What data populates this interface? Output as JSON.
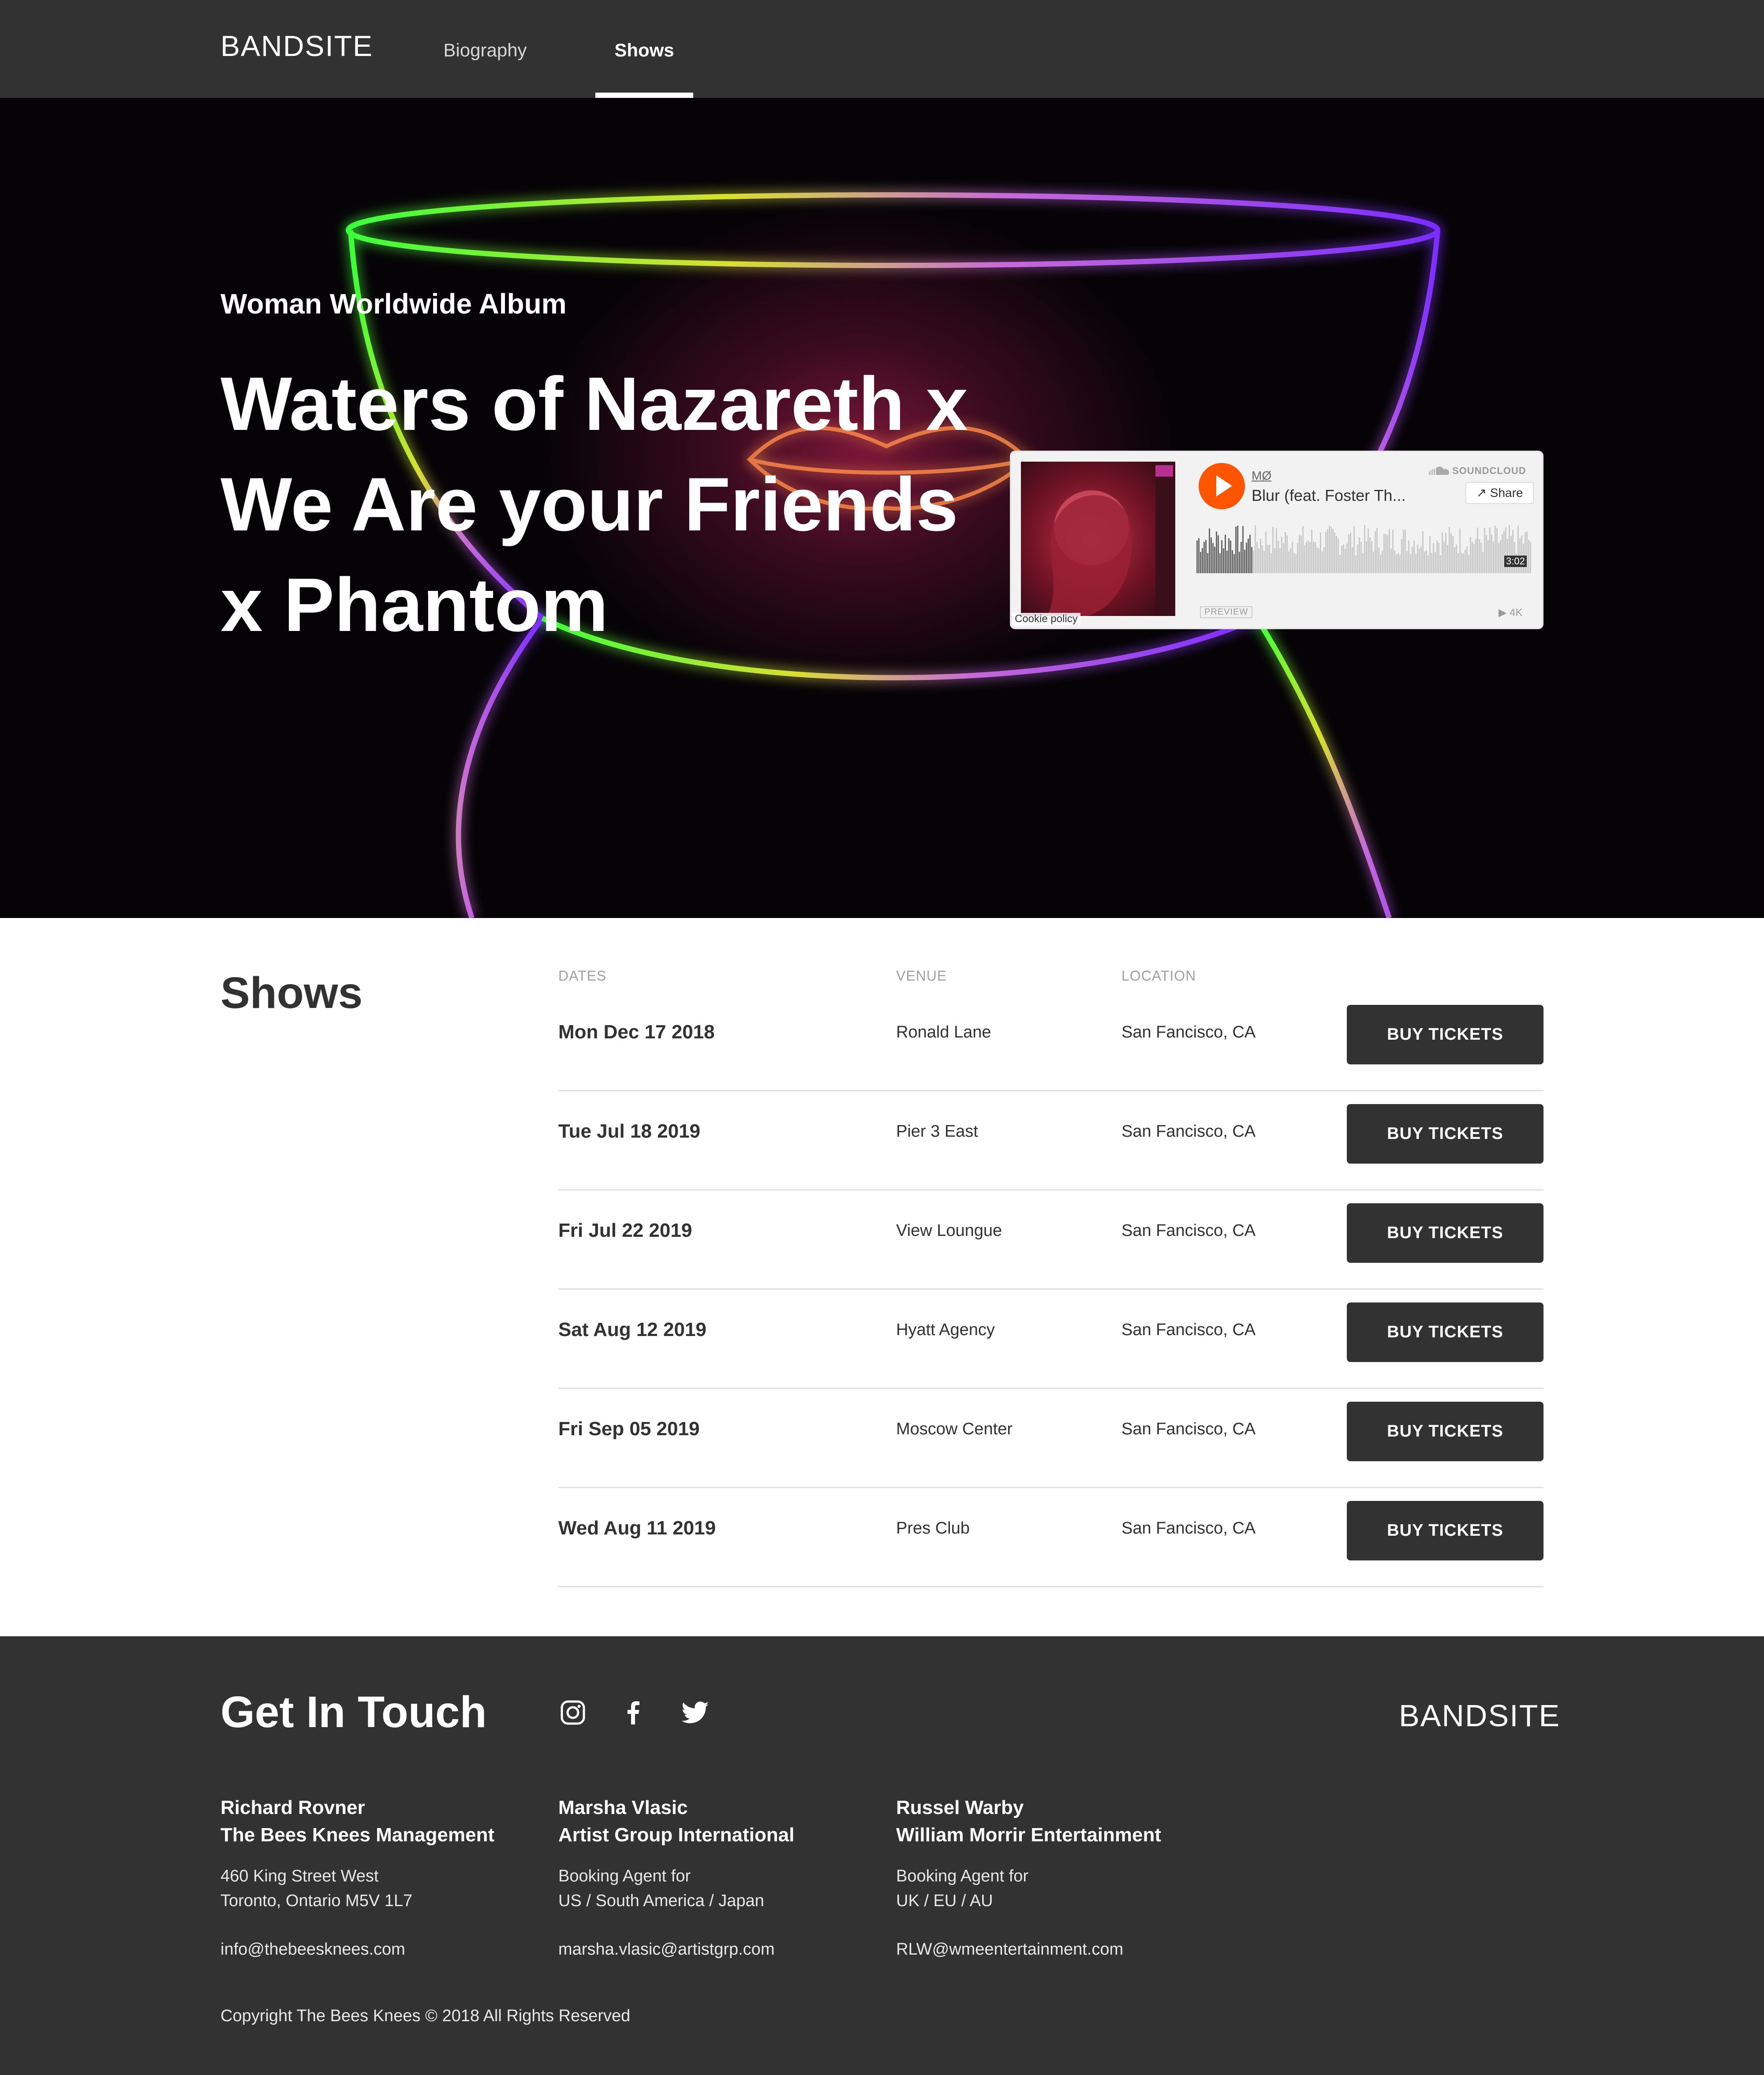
{
  "nav": {
    "logo": "BANDSITE",
    "links": [
      {
        "label": "Biography",
        "active": false
      },
      {
        "label": "Shows",
        "active": true
      }
    ]
  },
  "hero": {
    "subtitle": "Woman Worldwide Album",
    "title": "Waters of Nazareth x We Are your Friends x Phantom",
    "player": {
      "artist": "MØ",
      "track": "Blur (feat. Foster Th...",
      "brand": "SOUNDCLOUD",
      "share_label": "Share",
      "duration": "3:02",
      "preview_label": "PREVIEW",
      "plays": "▶ 4K",
      "cookie_label": "Cookie policy",
      "accent_color": "#ff5500"
    }
  },
  "shows": {
    "title": "Shows",
    "columns": {
      "dates": "DATES",
      "venue": "VENUE",
      "location": "LOCATION"
    },
    "button_label": "BUY TICKETS",
    "rows": [
      {
        "date": "Mon Dec 17 2018",
        "venue": "Ronald Lane",
        "location": "San Fancisco, CA"
      },
      {
        "date": "Tue Jul 18 2019",
        "venue": "Pier 3 East",
        "location": "San Fancisco, CA"
      },
      {
        "date": "Fri Jul 22 2019",
        "venue": "View Loungue",
        "location": "San Fancisco, CA"
      },
      {
        "date": "Sat Aug 12 2019",
        "venue": "Hyatt Agency",
        "location": "San Fancisco, CA"
      },
      {
        "date": "Fri Sep 05 2019",
        "venue": "Moscow Center",
        "location": "San Fancisco, CA"
      },
      {
        "date": "Wed Aug 11 2019",
        "venue": "Pres Club",
        "location": "San Fancisco, CA"
      }
    ]
  },
  "footer": {
    "title": "Get In Touch",
    "social_icons": [
      "instagram-icon",
      "facebook-icon",
      "twitter-icon"
    ],
    "logo": "BANDSITE",
    "contacts": [
      {
        "name": "Richard Rovner",
        "org": "The Bees Knees Management",
        "line1": "460 King Street West",
        "line2": "Toronto, Ontario M5V 1L7",
        "email": "info@thebeesknees.com"
      },
      {
        "name": "Marsha Vlasic",
        "org": "Artist Group International",
        "line1": "Booking Agent for",
        "line2": "US / South America / Japan",
        "email": "marsha.vlasic@artistgrp.com"
      },
      {
        "name": "Russel Warby",
        "org": "William Morrir Entertainment",
        "line1": "Booking Agent for",
        "line2": "UK / EU / AU",
        "email": "RLW@wmeentertainment.com"
      }
    ],
    "copyright": "Copyright The Bees Knees © 2018 All Rights Reserved"
  },
  "colors": {
    "dark": "#323232",
    "divider": "#e1e1e1",
    "muted": "#a0a0a0"
  }
}
